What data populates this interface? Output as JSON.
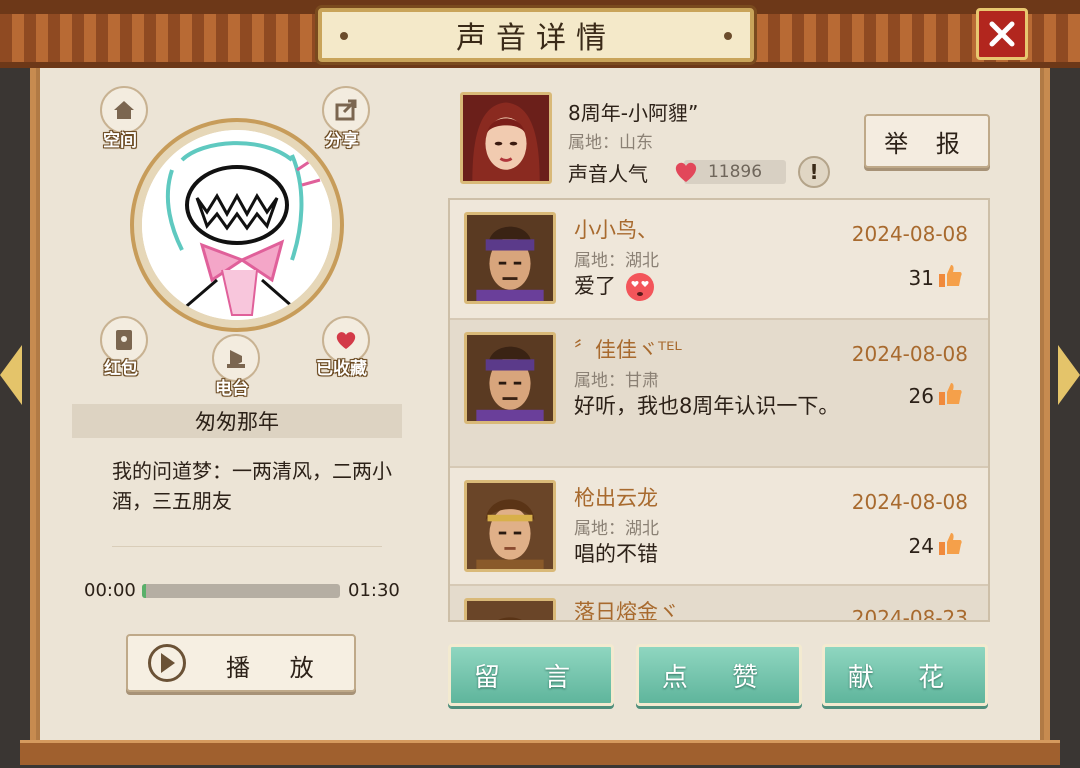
{
  "window": {
    "title": "声音详情"
  },
  "profile": {
    "space_label": "空间",
    "share_label": "分享",
    "red_packet_label": "红包",
    "radio_label": "电台",
    "favorite_label": "已收藏",
    "nickname": "匆匆那年",
    "signature": "我的问道梦：一两清风，二两小酒，三五朋友"
  },
  "player": {
    "current_time": "00:00",
    "total_time": "01:30",
    "progress": 0.02,
    "play_label": "播 放"
  },
  "author": {
    "name": "8周年-小阿貍”",
    "region": "属地：山东",
    "popularity_label": "声音人气",
    "popularity_value": "11896",
    "report_label": "举 报",
    "info_icon": "!"
  },
  "comments": [
    {
      "name": "小小鸟、",
      "region": "属地：湖北",
      "text": "爱了",
      "date": "2024-08-08",
      "likes": "31",
      "emoji": "heart-eyes"
    },
    {
      "name": "〞佳佳ヾᵀᴱᴸ",
      "region": "属地：甘肃",
      "text": "好听，我也8周年认识一下。",
      "date": "2024-08-08",
      "likes": "26"
    },
    {
      "name": "枪出云龙",
      "region": "属地：湖北",
      "text": "唱的不错",
      "date": "2024-08-08",
      "likes": "24"
    },
    {
      "name": "落日熔金ヾ",
      "region": "",
      "text": "",
      "date": "2024-08-23",
      "likes": ""
    }
  ],
  "actions": {
    "comment_label": "留 言",
    "like_label": "点 赞",
    "flower_label": "献 花"
  },
  "colors": {
    "accent_green": "#6fc2a8",
    "close_red": "#b2261e",
    "name_brown": "#a86a2e"
  }
}
